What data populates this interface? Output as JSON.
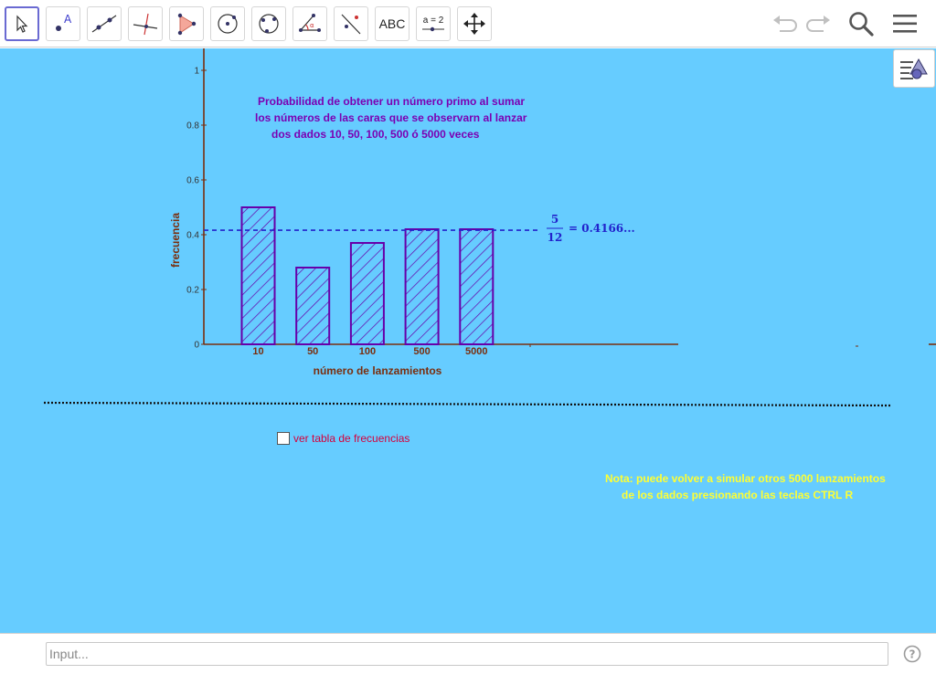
{
  "toolbar": {
    "tools": [
      {
        "name": "move-tool",
        "label": ""
      },
      {
        "name": "point-tool",
        "label": ""
      },
      {
        "name": "line-tool",
        "label": ""
      },
      {
        "name": "perpendicular-line-tool",
        "label": ""
      },
      {
        "name": "polygon-tool",
        "label": ""
      },
      {
        "name": "circle-center-point-tool",
        "label": ""
      },
      {
        "name": "circle-three-points-tool",
        "label": ""
      },
      {
        "name": "angle-tool",
        "label": ""
      },
      {
        "name": "reflect-tool",
        "label": ""
      },
      {
        "name": "text-tool",
        "label": "ABC"
      },
      {
        "name": "slider-tool",
        "label": "a = 2"
      },
      {
        "name": "move-graphics-view-tool",
        "label": ""
      }
    ],
    "right_icons": [
      "undo-icon",
      "redo-icon",
      "search-icon",
      "menu-icon"
    ]
  },
  "graphics": {
    "background": "#66ccff",
    "title_lines": [
      "Probabilidad de obtener un número primo al sumar",
      "los números de las caras que se observarn al lanzar",
      "dos dados 10, 50, 100, 500 ó 5000 veces"
    ],
    "checkbox_label": "ver tabla de frecuencias",
    "note_lines": [
      "Nota:  puede volver a simular otros 5000 lanzamientos",
      "de los dados presionando las teclas CTRL R"
    ]
  },
  "chart_data": {
    "type": "bar",
    "categories": [
      "10",
      "50",
      "100",
      "500",
      "5000"
    ],
    "values": [
      0.5,
      0.28,
      0.37,
      0.42,
      0.42
    ],
    "xlabel": "número de lanzamientos",
    "ylabel": "frecuencia",
    "yticks": [
      "0",
      "0.2",
      "0.4",
      "0.6",
      "0.8",
      "1"
    ],
    "ylim": [
      0,
      1
    ],
    "reference_line": {
      "value": 0.4166,
      "label_num": "5",
      "label_den": "12",
      "label_rest": "= 0.4166..."
    },
    "bar_color": "#6600aa",
    "axis_color": "#7a2e0e",
    "fill_pattern": "diagonal-hatch"
  },
  "input_bar": {
    "placeholder": "Input..."
  }
}
